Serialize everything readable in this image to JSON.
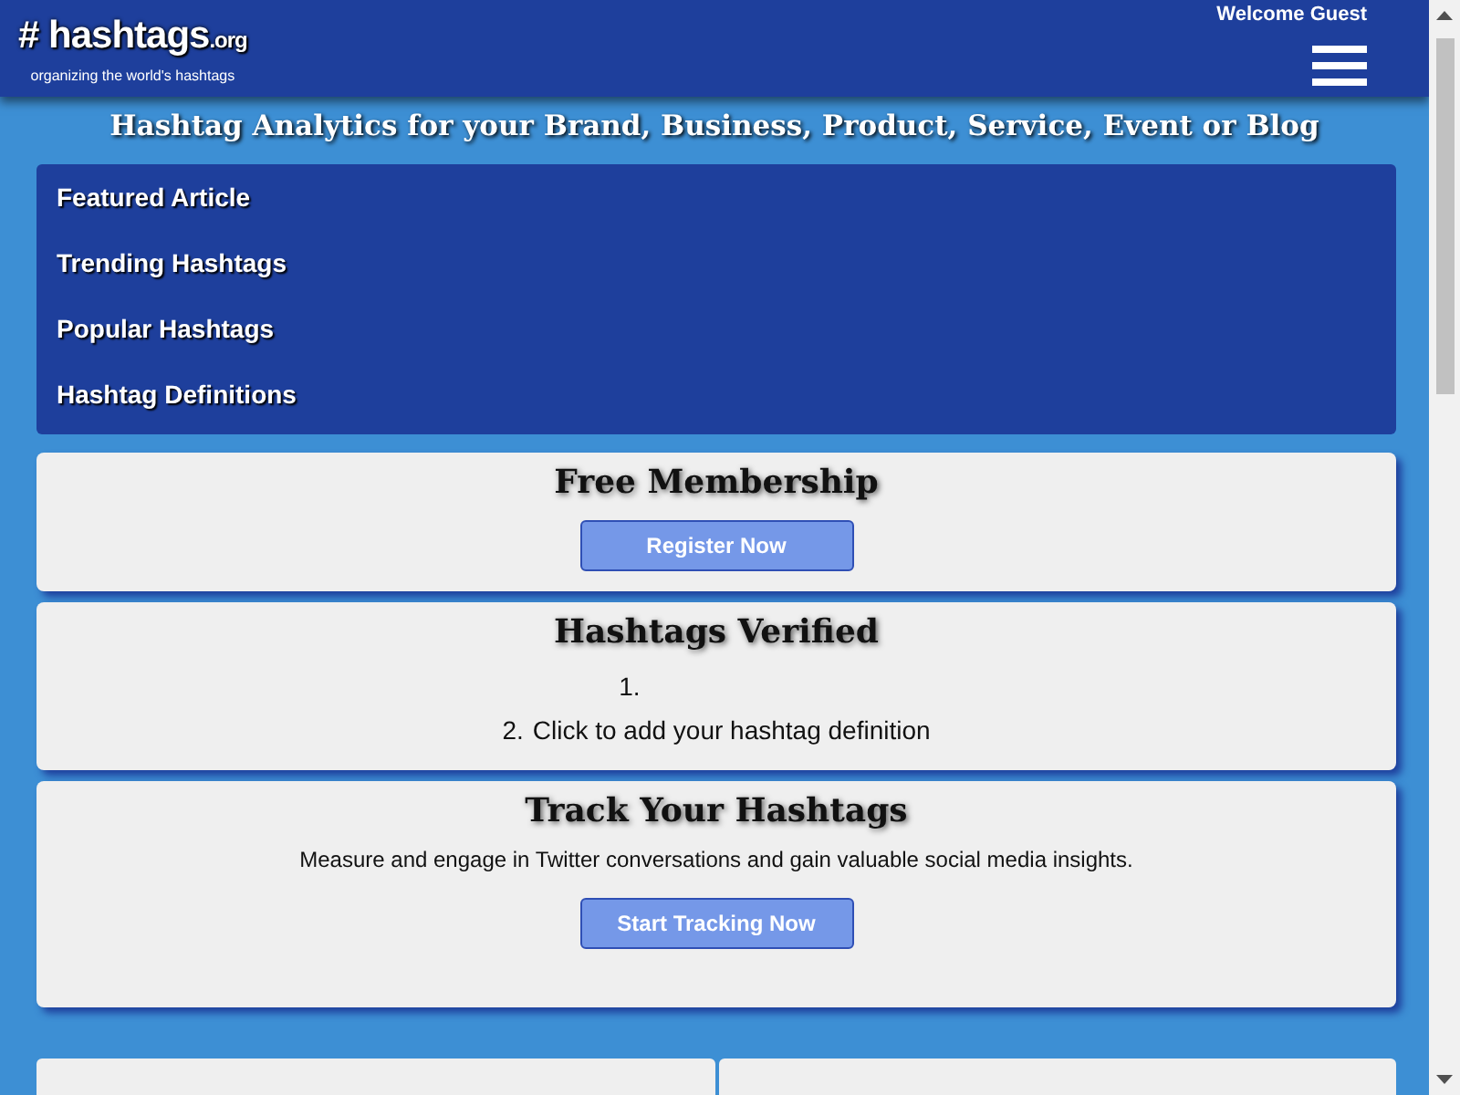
{
  "header": {
    "logo": {
      "hash": "#",
      "name": "hashtags",
      "tld": ".org",
      "tagline": "organizing the world's hashtags"
    },
    "welcome": "Welcome Guest"
  },
  "headline": "Hashtag Analytics for your Brand, Business, Product, Service, Event or Blog",
  "nav": [
    "Featured Article",
    "Trending Hashtags",
    "Popular Hashtags",
    "Hashtag Definitions"
  ],
  "membership": {
    "title": "Free Membership",
    "button": "Register Now"
  },
  "verified": {
    "title": "Hashtags Verified",
    "items": [
      {
        "number": "1."
      },
      {
        "number": "2.",
        "text": "Click to add your hashtag definition"
      }
    ]
  },
  "track": {
    "title": "Track Your Hashtags",
    "text": "Measure and engage in Twitter conversations and gain valuable social media insights.",
    "button": "Start Tracking Now"
  }
}
